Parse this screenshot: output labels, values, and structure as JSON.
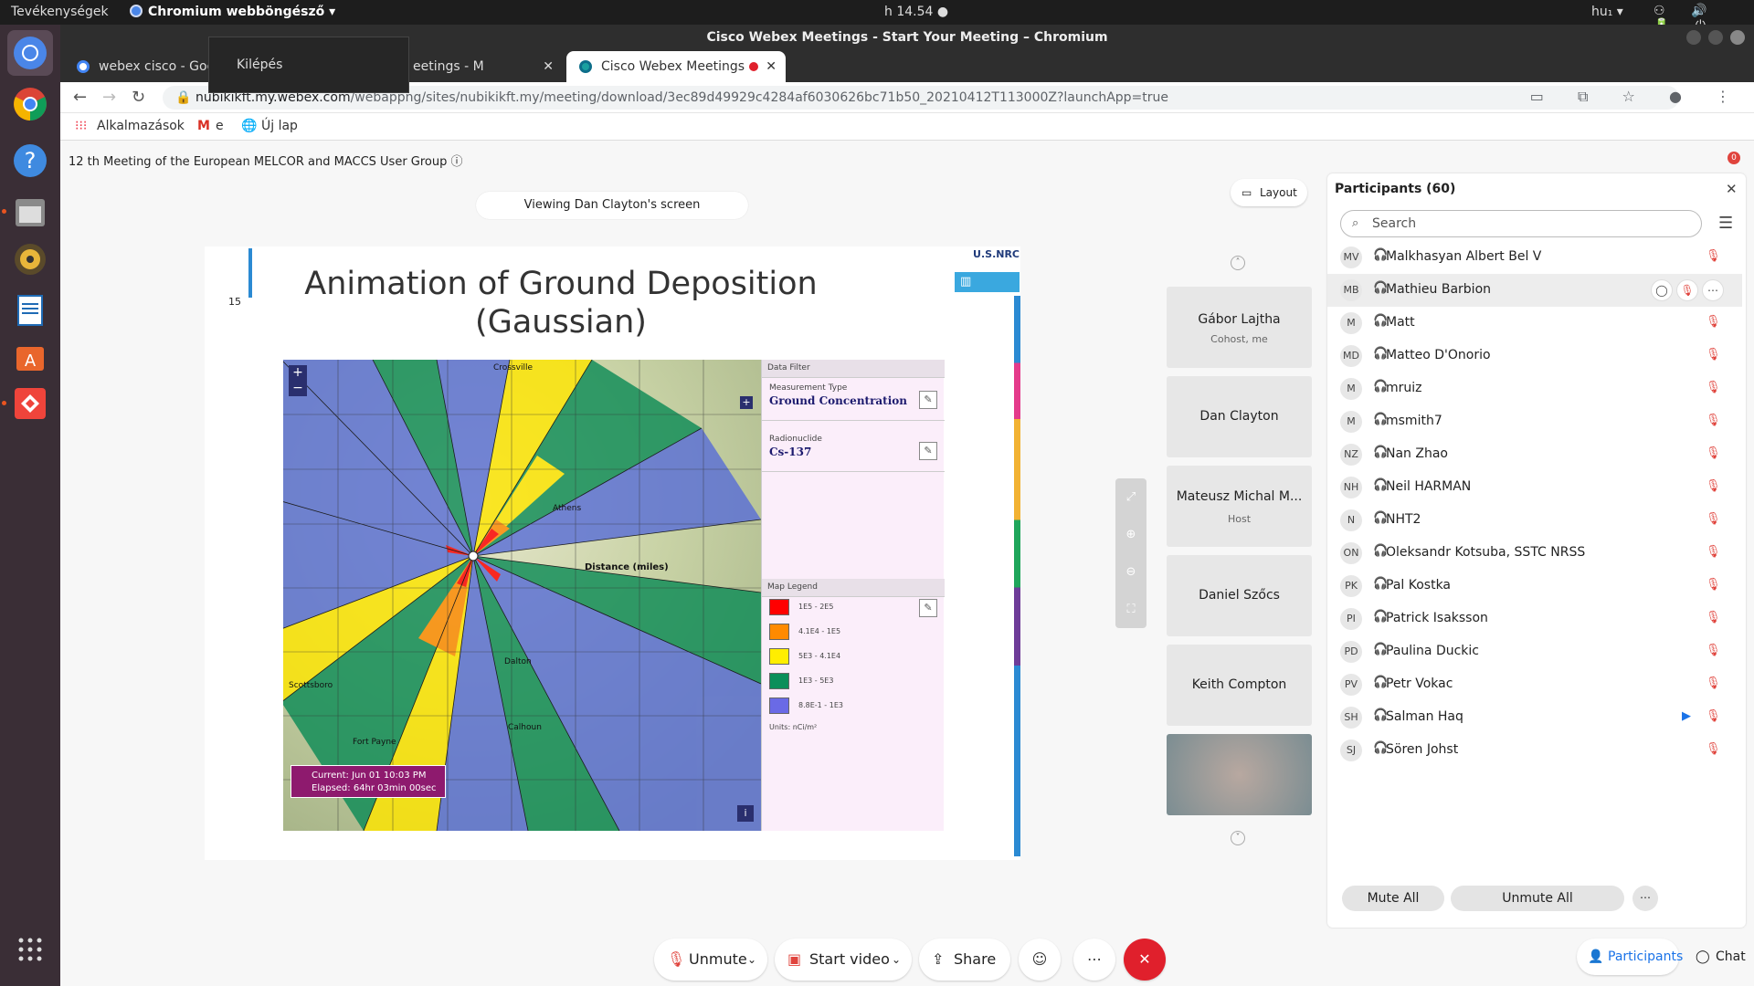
{
  "os": {
    "activities": "Tevékenységek",
    "app_name": "Chromium webböngésző ▾",
    "clock": "h 14.54 ●",
    "lang": "hu₁ ▾",
    "tray": "⚇ 🔊 🔋 ⏻"
  },
  "browser": {
    "window_title": "Cisco Webex Meetings - Start Your Meeting – Chromium",
    "tabs": [
      {
        "label": "webex cisco - Goo"
      },
      {
        "label": "eetings - M"
      },
      {
        "label": "Cisco Webex Meetings"
      }
    ],
    "tooltip": "Kilépés",
    "url_host": "nubikikft.my.webex.com",
    "url_path": "/webappng/sites/nubikikft.my/meeting/download/3ec89d49929c4284af6030626bc71b50_20210412T113000Z?launchApp=true",
    "bookmarks": [
      "Alkalmazások",
      "e",
      "Új lap"
    ]
  },
  "meeting": {
    "title": "12 th Meeting of the European MELCOR and MACCS User Group",
    "notif_count": "0",
    "viewing": "Viewing Dan Clayton's screen",
    "layout_label": "Layout"
  },
  "slide": {
    "number": "15",
    "title_line1": "Animation of Ground Deposition",
    "title_line2": "(Gaussian)",
    "logo_text": "U.S.NRC",
    "map": {
      "places": [
        "Crossville",
        "Athens",
        "Scottsboro",
        "Dalton",
        "Calhoun",
        "Fort Payne"
      ],
      "distance_label": "Distance (miles)",
      "time_current": "Current: Jun 01 10:03 PM",
      "time_elapsed": "Elapsed: 64hr 03min 00sec"
    },
    "filter": {
      "header": "Data Filter",
      "measurement_label": "Measurement Type",
      "measurement_value": "Ground Concentration",
      "radionuclide_label": "Radionuclide",
      "radionuclide_value": "Cs-137"
    },
    "legend": {
      "header": "Map Legend",
      "items": [
        {
          "label": "1E5 - 2E5",
          "color": "#ff0000"
        },
        {
          "label": "4.1E4 - 1E5",
          "color": "#ff8a00"
        },
        {
          "label": "5E3 - 4.1E4",
          "color": "#ffee00"
        },
        {
          "label": "1E3 - 5E3",
          "color": "#0a8f5a"
        },
        {
          "label": "8.8E-1 - 1E3",
          "color": "#6a6ae6"
        }
      ],
      "units": "Units: nCi/m²"
    }
  },
  "videos": [
    {
      "name": "Gábor Lajtha",
      "sub": "Cohost, me"
    },
    {
      "name": "Dan Clayton",
      "sub": ""
    },
    {
      "name": "Mateusz Michal M...",
      "sub": "Host"
    },
    {
      "name": "Daniel Szőcs",
      "sub": ""
    },
    {
      "name": "Keith Compton",
      "sub": ""
    }
  ],
  "participants": {
    "title": "Participants (60)",
    "search_placeholder": "Search",
    "list": [
      {
        "initials": "MV",
        "name": "Malkhasyan Albert Bel V"
      },
      {
        "initials": "MB",
        "name": "Mathieu Barbion"
      },
      {
        "initials": "M",
        "name": "Matt"
      },
      {
        "initials": "MD",
        "name": "Matteo D'Onorio"
      },
      {
        "initials": "M",
        "name": "mruiz"
      },
      {
        "initials": "M",
        "name": "msmith7"
      },
      {
        "initials": "NZ",
        "name": "Nan Zhao"
      },
      {
        "initials": "NH",
        "name": "Neil HARMAN"
      },
      {
        "initials": "N",
        "name": "NHT2"
      },
      {
        "initials": "ON",
        "name": "Oleksandr Kotsuba, SSTC NRSS"
      },
      {
        "initials": "PK",
        "name": "Pal Kostka"
      },
      {
        "initials": "PI",
        "name": "Patrick Isaksson"
      },
      {
        "initials": "PD",
        "name": "Paulina Duckic"
      },
      {
        "initials": "PV",
        "name": "Petr Vokac"
      },
      {
        "initials": "SH",
        "name": "Salman Haq"
      },
      {
        "initials": "SJ",
        "name": "Sören Johst"
      }
    ],
    "mute_all": "Mute All",
    "unmute_all": "Unmute All"
  },
  "controls": {
    "unmute": "Unmute",
    "start_video": "Start video",
    "share": "Share",
    "participants_tab": "Participants",
    "chat_tab": "Chat"
  },
  "colors": {
    "accent": "#1a73e8",
    "end_call": "#e0202c",
    "muted": "#e0443d"
  }
}
